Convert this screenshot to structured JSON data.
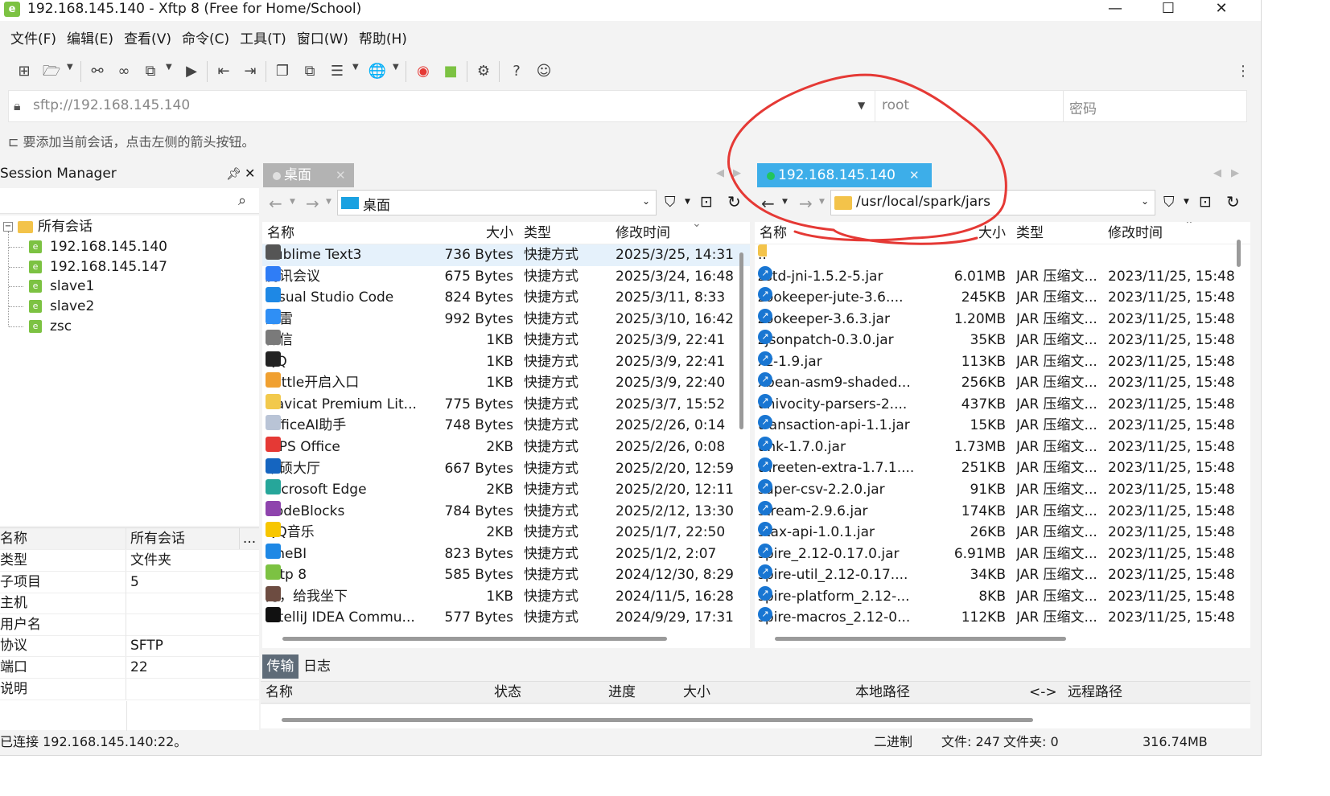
{
  "window": {
    "title": "192.168.145.140 - Xftp 8 (Free for Home/School)",
    "app_icon": "xftp-app-icon"
  },
  "menu": [
    "文件(F)",
    "编辑(E)",
    "查看(V)",
    "命令(C)",
    "工具(T)",
    "窗口(W)",
    "帮助(H)"
  ],
  "address": {
    "url": "sftp://192.168.145.140",
    "user": "root",
    "password_placeholder": "密码"
  },
  "hint": "要添加当前会话，点击左侧的箭头按钮。",
  "session_manager": {
    "title": "Session Manager",
    "root": "所有会话",
    "sessions": [
      "192.168.145.140",
      "192.168.145.147",
      "slave1",
      "slave2",
      "zsc"
    ]
  },
  "properties": {
    "header": {
      "key": "名称",
      "value": "所有会话",
      "more": "..."
    },
    "rows": [
      {
        "key": "类型",
        "value": "文件夹"
      },
      {
        "key": "子项目",
        "value": "5"
      },
      {
        "key": "主机",
        "value": ""
      },
      {
        "key": "用户名",
        "value": ""
      },
      {
        "key": "协议",
        "value": "SFTP"
      },
      {
        "key": "端口",
        "value": "22"
      },
      {
        "key": "说明",
        "value": ""
      }
    ]
  },
  "local": {
    "tab": "桌面",
    "path": "桌面",
    "columns": [
      "名称",
      "大小",
      "类型",
      "修改时间"
    ],
    "files": [
      {
        "name": "Sublime Text3",
        "size": "736 Bytes",
        "type": "快捷方式",
        "mtime": "2025/3/25, 14:31",
        "color": "#555555"
      },
      {
        "name": "腾讯会议",
        "size": "675 Bytes",
        "type": "快捷方式",
        "mtime": "2025/3/24, 16:48",
        "color": "#2f7df6"
      },
      {
        "name": "Visual Studio Code",
        "size": "824 Bytes",
        "type": "快捷方式",
        "mtime": "2025/3/11, 8:33",
        "color": "#1e88e5"
      },
      {
        "name": "迅雷",
        "size": "992 Bytes",
        "type": "快捷方式",
        "mtime": "2025/3/10, 16:42",
        "color": "#2f8ff5"
      },
      {
        "name": "微信",
        "size": "1KB",
        "type": "快捷方式",
        "mtime": "2025/3/9, 22:41",
        "color": "#7a7a7a"
      },
      {
        "name": "QQ",
        "size": "1KB",
        "type": "快捷方式",
        "mtime": "2025/3/9, 22:41",
        "color": "#222222"
      },
      {
        "name": "kettle开启入口",
        "size": "1KB",
        "type": "快捷方式",
        "mtime": "2025/3/9, 22:40",
        "color": "#f0a030"
      },
      {
        "name": "Navicat Premium Lit...",
        "size": "775 Bytes",
        "type": "快捷方式",
        "mtime": "2025/3/7, 15:52",
        "color": "#f2c94c"
      },
      {
        "name": "OfficeAI助手",
        "size": "748 Bytes",
        "type": "快捷方式",
        "mtime": "2025/2/26, 0:14",
        "color": "#b9c4d6"
      },
      {
        "name": "WPS Office",
        "size": "2KB",
        "type": "快捷方式",
        "mtime": "2025/2/26, 0:08",
        "color": "#e53935"
      },
      {
        "name": "华硕大厅",
        "size": "667 Bytes",
        "type": "快捷方式",
        "mtime": "2025/2/20, 12:59",
        "color": "#1565c0"
      },
      {
        "name": "Microsoft Edge",
        "size": "2KB",
        "type": "快捷方式",
        "mtime": "2025/2/20, 12:11",
        "color": "#26a69a"
      },
      {
        "name": "CodeBlocks",
        "size": "784 Bytes",
        "type": "快捷方式",
        "mtime": "2025/2/12, 13:30",
        "color": "#8e44ad"
      },
      {
        "name": "QQ音乐",
        "size": "2KB",
        "type": "快捷方式",
        "mtime": "2025/1/7, 22:50",
        "color": "#f7c600"
      },
      {
        "name": "FineBI",
        "size": "823 Bytes",
        "type": "快捷方式",
        "mtime": "2025/1/2, 2:07",
        "color": "#1e88e5"
      },
      {
        "name": "Xftp 8",
        "size": "585 Bytes",
        "type": "快捷方式",
        "mtime": "2024/12/30, 8:29",
        "color": "#7cc242"
      },
      {
        "name": "秀，给我坐下",
        "size": "1KB",
        "type": "快捷方式",
        "mtime": "2024/11/5, 16:28",
        "color": "#6d4c41"
      },
      {
        "name": "IntelliJ IDEA Commu...",
        "size": "577 Bytes",
        "type": "快捷方式",
        "mtime": "2024/9/29, 17:31",
        "color": "#111111"
      }
    ]
  },
  "remote": {
    "tab": "192.168.145.140",
    "path": "/usr/local/spark/jars",
    "columns": [
      "名称",
      "大小",
      "类型",
      "修改时间"
    ],
    "parent": "..",
    "files": [
      {
        "name": "zstd-jni-1.5.2-5.jar",
        "size": "6.01MB",
        "type": "JAR 压缩文...",
        "mtime": "2023/11/25, 15:48"
      },
      {
        "name": "zookeeper-jute-3.6....",
        "size": "245KB",
        "type": "JAR 压缩文...",
        "mtime": "2023/11/25, 15:48"
      },
      {
        "name": "zookeeper-3.6.3.jar",
        "size": "1.20MB",
        "type": "JAR 压缩文...",
        "mtime": "2023/11/25, 15:48"
      },
      {
        "name": "zjsonpatch-0.3.0.jar",
        "size": "35KB",
        "type": "JAR 压缩文...",
        "mtime": "2023/11/25, 15:48"
      },
      {
        "name": "xz-1.9.jar",
        "size": "113KB",
        "type": "JAR 压缩文...",
        "mtime": "2023/11/25, 15:48"
      },
      {
        "name": "xbean-asm9-shaded...",
        "size": "256KB",
        "type": "JAR 压缩文...",
        "mtime": "2023/11/25, 15:48"
      },
      {
        "name": "univocity-parsers-2....",
        "size": "437KB",
        "type": "JAR 压缩文...",
        "mtime": "2023/11/25, 15:48"
      },
      {
        "name": "transaction-api-1.1.jar",
        "size": "15KB",
        "type": "JAR 压缩文...",
        "mtime": "2023/11/25, 15:48"
      },
      {
        "name": "tink-1.7.0.jar",
        "size": "1.73MB",
        "type": "JAR 压缩文...",
        "mtime": "2023/11/25, 15:48"
      },
      {
        "name": "threeten-extra-1.7.1....",
        "size": "251KB",
        "type": "JAR 压缩文...",
        "mtime": "2023/11/25, 15:48"
      },
      {
        "name": "super-csv-2.2.0.jar",
        "size": "91KB",
        "type": "JAR 压缩文...",
        "mtime": "2023/11/25, 15:48"
      },
      {
        "name": "stream-2.9.6.jar",
        "size": "174KB",
        "type": "JAR 压缩文...",
        "mtime": "2023/11/25, 15:48"
      },
      {
        "name": "stax-api-1.0.1.jar",
        "size": "26KB",
        "type": "JAR 压缩文...",
        "mtime": "2023/11/25, 15:48"
      },
      {
        "name": "spire_2.12-0.17.0.jar",
        "size": "6.91MB",
        "type": "JAR 压缩文...",
        "mtime": "2023/11/25, 15:48"
      },
      {
        "name": "spire-util_2.12-0.17....",
        "size": "34KB",
        "type": "JAR 压缩文...",
        "mtime": "2023/11/25, 15:48"
      },
      {
        "name": "spire-platform_2.12-...",
        "size": "8KB",
        "type": "JAR 压缩文...",
        "mtime": "2023/11/25, 15:48"
      },
      {
        "name": "spire-macros_2.12-0...",
        "size": "112KB",
        "type": "JAR 压缩文...",
        "mtime": "2023/11/25, 15:48"
      }
    ]
  },
  "transfer": {
    "tabs": [
      "传输",
      "日志"
    ],
    "columns": [
      "名称",
      "状态",
      "进度",
      "大小",
      "本地路径",
      "<->",
      "远程路径"
    ]
  },
  "status": {
    "left": "已连接 192.168.145.140:22。",
    "mode": "二进制",
    "files": "文件: 247",
    "folders": "文件夹: 0",
    "size": "316.74MB"
  },
  "colors": {
    "remote_tab": "#3daee9",
    "connected_dot": "#22c55e",
    "annotation": "#e53935",
    "transfer_tab": "#5e6b78"
  }
}
